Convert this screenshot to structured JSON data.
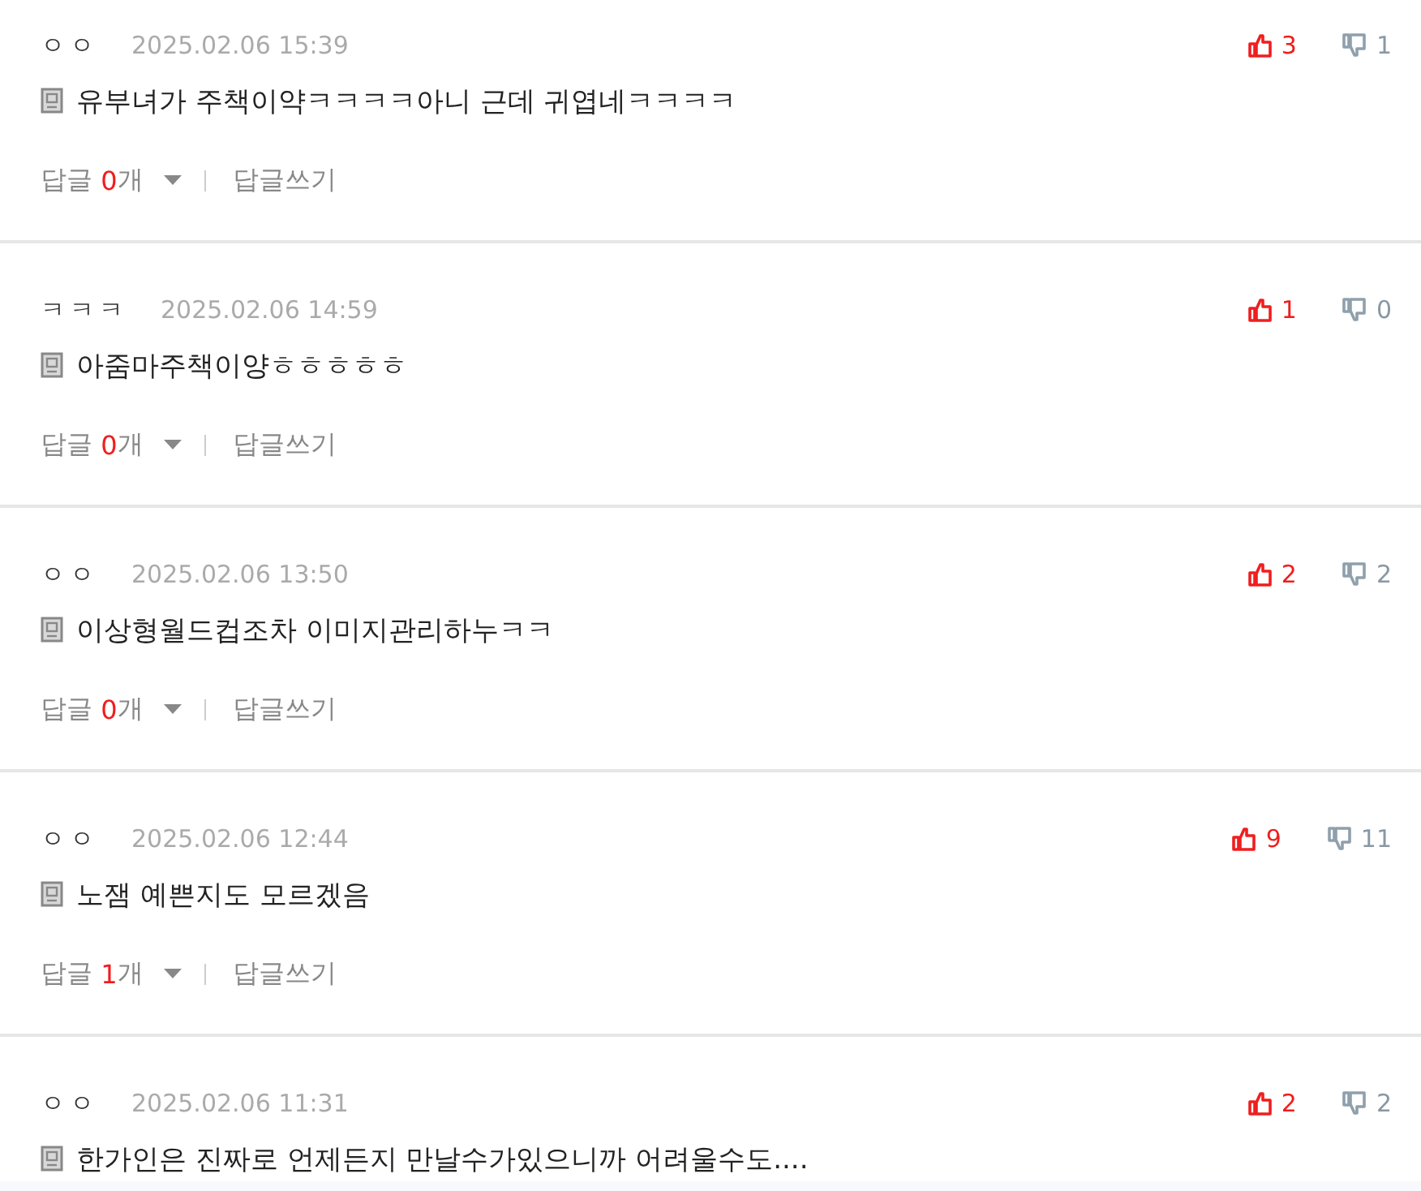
{
  "comments": [
    {
      "author": "ㅇㅇ",
      "date": "2025.02.06 15:39",
      "text": "유부녀가 주책이약ㅋㅋㅋㅋ아니 근데 귀엽네ㅋㅋㅋㅋ",
      "likes": "3",
      "dislikes": "1",
      "replies": {
        "label": "답글",
        "count": "0",
        "unit": "개",
        "write": "답글쓰기"
      }
    },
    {
      "author": "ㅋㅋㅋ",
      "date": "2025.02.06 14:59",
      "text": "아줌마주책이양ㅎㅎㅎㅎㅎ",
      "likes": "1",
      "dislikes": "0",
      "replies": {
        "label": "답글",
        "count": "0",
        "unit": "개",
        "write": "답글쓰기"
      }
    },
    {
      "author": "ㅇㅇ",
      "date": "2025.02.06 13:50",
      "text": "이상형월드컵조차 이미지관리하누ㅋㅋ",
      "likes": "2",
      "dislikes": "2",
      "replies": {
        "label": "답글",
        "count": "0",
        "unit": "개",
        "write": "답글쓰기"
      }
    },
    {
      "author": "ㅇㅇ",
      "date": "2025.02.06 12:44",
      "text": "노잼 예쁜지도 모르겠음",
      "likes": "9",
      "dislikes": "11",
      "replies": {
        "label": "답글",
        "count": "1",
        "unit": "개",
        "write": "답글쓰기"
      }
    },
    {
      "author": "ㅇㅇ",
      "date": "2025.02.06 11:31",
      "text": "한가인은 진짜로 언제든지 만날수가있으니까 어려울수도....",
      "likes": "2",
      "dislikes": "2"
    }
  ]
}
